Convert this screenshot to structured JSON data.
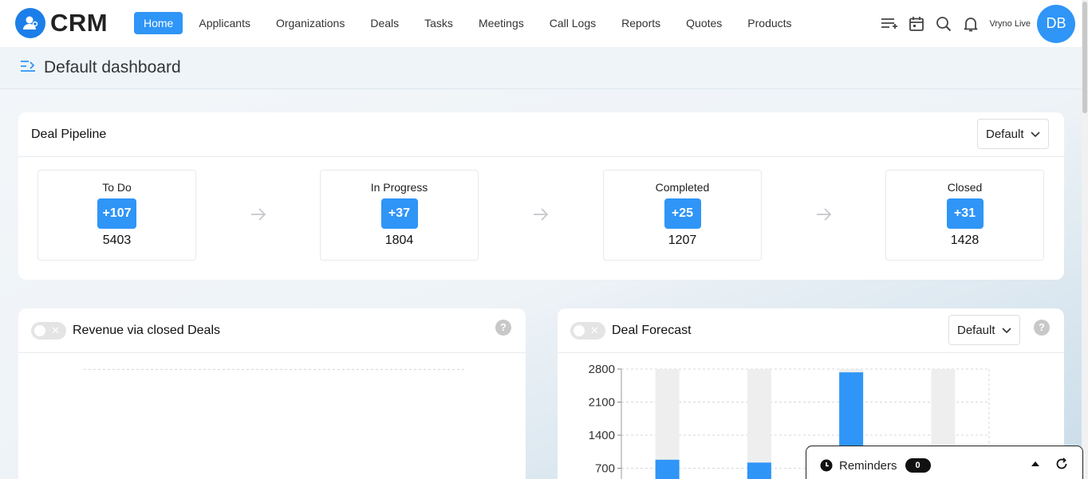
{
  "app": {
    "logo_text": "CRM"
  },
  "nav": {
    "items": [
      {
        "label": "Home",
        "active": true
      },
      {
        "label": "Applicants"
      },
      {
        "label": "Organizations"
      },
      {
        "label": "Deals"
      },
      {
        "label": "Tasks"
      },
      {
        "label": "Meetings"
      },
      {
        "label": "Call Logs"
      },
      {
        "label": "Reports"
      },
      {
        "label": "Quotes"
      },
      {
        "label": "Products"
      }
    ],
    "user_name": "Vryno Live",
    "avatar_initials": "DB",
    "icons": [
      "add-list-icon",
      "calendar-icon",
      "search-icon",
      "bell-icon"
    ]
  },
  "page": {
    "title": "Default dashboard"
  },
  "pipeline": {
    "title": "Deal Pipeline",
    "dropdown_value": "Default",
    "stages": [
      {
        "name": "To Do",
        "delta": "+107",
        "count": "5403"
      },
      {
        "name": "In Progress",
        "delta": "+37",
        "count": "1804"
      },
      {
        "name": "Completed",
        "delta": "+25",
        "count": "1207"
      },
      {
        "name": "Closed",
        "delta": "+31",
        "count": "1428"
      }
    ]
  },
  "revenue": {
    "title": "Revenue via closed Deals",
    "help": "?"
  },
  "forecast": {
    "title": "Deal Forecast",
    "dropdown_value": "Default",
    "help": "?"
  },
  "chart_data": {
    "type": "bar",
    "y_ticks": [
      "2800",
      "2100",
      "1400",
      "700"
    ],
    "ylim": [
      0,
      2800
    ],
    "series": [
      {
        "values": [
          2800,
          2800,
          2800,
          2800
        ],
        "color": "#eeeeee"
      },
      {
        "values": [
          880,
          820,
          2730,
          0
        ],
        "color": "#2f95f7"
      }
    ],
    "grid": true
  },
  "reminders": {
    "label": "Reminders",
    "count": "0"
  },
  "colors": {
    "accent": "#2f95f7",
    "logo": "#1c7ee8"
  }
}
